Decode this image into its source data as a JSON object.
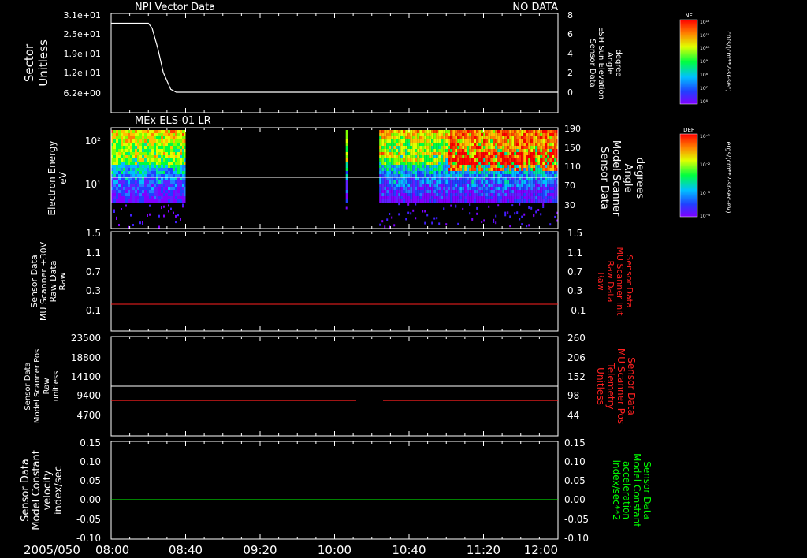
{
  "colors": {
    "background": "#000000",
    "frame": "#ffffff",
    "red": "#ff2020",
    "green": "#00ff00",
    "grid": "#ffffff"
  },
  "time_axis": {
    "date_label": "2005/050",
    "ticks": [
      "08:00",
      "08:40",
      "09:20",
      "10:00",
      "10:40",
      "11:20",
      "12:00"
    ]
  },
  "panel1": {
    "title": "NPI Vector Data",
    "status": "NO DATA",
    "left_label_lines": [
      "Sector",
      "Unitless"
    ],
    "left_ticks": [
      "3.1e+01",
      "2.5e+01",
      "1.9e+01",
      "1.2e+01",
      "6.2e+00"
    ],
    "right_label_lines": [
      "Sensor Data",
      "ESH Sun Elevation",
      "Angle",
      "degree"
    ],
    "right_ticks": [
      "8",
      "6",
      "4",
      "2",
      "0"
    ],
    "colorbar_title": "NF",
    "colorbar_unit": "cnts/(cm**2-sr-sec)",
    "colorbar_ticks": [
      "10¹²",
      "10¹¹",
      "10¹⁰",
      "10⁹",
      "10⁸",
      "10⁷",
      "10⁶"
    ]
  },
  "panel2": {
    "title": "MEx ELS-01 LR",
    "left_label_lines": [
      "Electron Energy",
      "eV"
    ],
    "left_ticks": [
      "10²",
      "10¹"
    ],
    "right_label_lines": [
      "Sensor Data",
      "Model Scanner",
      "Angle",
      "degrees"
    ],
    "right_ticks": [
      "190",
      "150",
      "110",
      "70",
      "30"
    ],
    "colorbar_title": "DEF",
    "colorbar_unit": "ergs/(cm**2-sr-sec-eV)",
    "colorbar_ticks": [
      "10⁻¹",
      "10⁻²",
      "10⁻³",
      "10⁻⁴"
    ]
  },
  "panel3": {
    "left_label_lines": [
      "Sensor Data",
      "MU Scanner +30V",
      "Raw Data",
      "Raw"
    ],
    "left_ticks": [
      "1.5",
      "1.1",
      "0.7",
      "0.3",
      "-0.1"
    ],
    "right_label_lines": [
      "Sensor Data",
      "MU Scanner Init",
      "Raw Data",
      "Raw"
    ],
    "right_ticks": [
      "1.5",
      "1.1",
      "0.7",
      "0.3",
      "-0.1"
    ]
  },
  "panel4": {
    "left_label_lines": [
      "Sensor Data",
      "Model Scanner Pos",
      "Raw",
      "unitless"
    ],
    "left_ticks": [
      "23500",
      "18800",
      "14100",
      "9400",
      "4700"
    ],
    "right_label_lines": [
      "Sensor Data",
      "MU Scanner Pos",
      "Telemetry",
      "Unitless"
    ],
    "right_ticks": [
      "260",
      "206",
      "152",
      "98",
      "44"
    ]
  },
  "panel5": {
    "left_label_lines": [
      "Sensor Data",
      "Model Constant",
      "velocity",
      "index/sec"
    ],
    "left_ticks": [
      "0.15",
      "0.10",
      "0.05",
      "0.00",
      "-0.05",
      "-0.10"
    ],
    "right_label_lines": [
      "Sensor Data",
      "Model Constant",
      "acceleration",
      "index/sec**2"
    ],
    "right_ticks": [
      "0.15",
      "0.10",
      "0.05",
      "0.00",
      "-0.05",
      "-0.10"
    ]
  },
  "chart_data": [
    {
      "type": "line",
      "panel": "NPI Vector Data",
      "x_range": [
        "08:00",
        "12:00"
      ],
      "ylim": [
        0,
        8
      ],
      "series": [
        {
          "x": [
            "08:00",
            "08:20",
            "08:22",
            "08:25",
            "08:28",
            "08:32",
            "08:35",
            "12:00"
          ],
          "values": [
            7.0,
            7.0,
            6.5,
            4.5,
            2.0,
            0.3,
            0.0,
            0.0
          ]
        }
      ]
    },
    {
      "type": "heatmap",
      "panel": "MEx ELS-01 LR",
      "x_range": [
        "08:00",
        "12:00"
      ],
      "y_scale": "log",
      "data_intervals": [
        [
          "08:00",
          "08:40"
        ],
        [
          "10:06",
          "10:07"
        ],
        [
          "10:24",
          "12:00"
        ]
      ],
      "high_flux_interval": [
        "11:00",
        "12:00"
      ],
      "overlay_line_value": 90
    },
    {
      "type": "line",
      "panel": "MU Scanner +30V / Init",
      "x_range": [
        "08:00",
        "12:00"
      ],
      "ylim": [
        -0.3,
        1.5
      ],
      "series": [
        {
          "x": [
            "08:00",
            "12:00"
          ],
          "values": [
            0.0,
            0.0
          ]
        }
      ]
    },
    {
      "type": "line",
      "panel": "Scanner Pos",
      "x_range": [
        "08:00",
        "12:00"
      ],
      "ylim": [
        0,
        23500
      ],
      "series": [
        {
          "x": [
            "08:00",
            "12:00"
          ],
          "values": [
            11700,
            11700
          ]
        },
        {
          "x": [
            "08:00",
            "10:04"
          ],
          "values": [
            8100,
            8100
          ]
        },
        {
          "x": [
            "10:16",
            "12:00"
          ],
          "values": [
            8100,
            8100
          ]
        }
      ]
    },
    {
      "type": "line",
      "panel": "Model Constant",
      "x_range": [
        "08:00",
        "12:00"
      ],
      "ylim": [
        -0.1,
        0.15
      ],
      "series": [
        {
          "x": [
            "08:00",
            "12:00"
          ],
          "values": [
            0.0,
            0.0
          ]
        }
      ]
    }
  ]
}
